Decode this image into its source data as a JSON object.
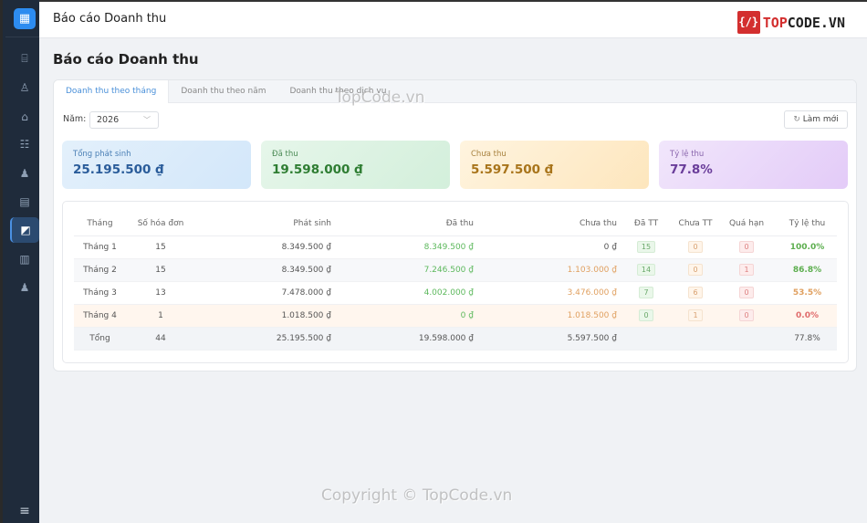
{
  "app": {
    "logo_icon": "building-icon",
    "header_title": "Báo cáo Doanh thu",
    "brand_prefix": "TOP",
    "brand_suffix": "CODE",
    "brand_dot": ".VN"
  },
  "sidebar": {
    "items": [
      {
        "icon": "presentation-chart-icon"
      },
      {
        "icon": "user-outline-icon"
      },
      {
        "icon": "home-icon"
      },
      {
        "icon": "checklist-icon"
      },
      {
        "icon": "user-icon"
      },
      {
        "icon": "document-icon"
      },
      {
        "icon": "chart-icon",
        "active": true
      },
      {
        "icon": "ledger-icon"
      },
      {
        "icon": "user-icon"
      }
    ],
    "toggle_icon": "menu-icon"
  },
  "page": {
    "title": "Báo cáo Doanh thu"
  },
  "tabs": [
    {
      "label": "Doanh thu theo tháng",
      "active": true
    },
    {
      "label": "Doanh thu theo năm"
    },
    {
      "label": "Doanh thu theo dịch vụ"
    }
  ],
  "filter": {
    "year_label": "Năm:",
    "year_value": "2026",
    "refresh_label": "Làm mới"
  },
  "stats": [
    {
      "label": "Tổng phát sinh",
      "value": "25.195.500 ₫",
      "color": "#2a5c9a"
    },
    {
      "label": "Đã thu",
      "value": "19.598.000 ₫",
      "color": "#2e7d32"
    },
    {
      "label": "Chưa thu",
      "value": "5.597.500 ₫",
      "color": "#a8741a"
    },
    {
      "label": "Tỷ lệ thu",
      "value": "77.8%",
      "color": "#6a3d9a"
    }
  ],
  "table": {
    "headers": [
      "Tháng",
      "Số hóa đơn",
      "Phát sinh",
      "Đã thu",
      "Chưa thu",
      "Đã TT",
      "Chưa TT",
      "Quá hạn",
      "Tỷ lệ thu"
    ],
    "rows": [
      [
        "Tháng 1",
        "15",
        "8.349.500 ₫",
        "8.349.500 ₫",
        "0 ₫",
        "15",
        "0",
        "0",
        "100.0%"
      ],
      [
        "Tháng 2",
        "15",
        "8.349.500 ₫",
        "7.246.500 ₫",
        "1.103.000 ₫",
        "14",
        "0",
        "1",
        "86.8%"
      ],
      [
        "Tháng 3",
        "13",
        "7.478.000 ₫",
        "4.002.000 ₫",
        "3.476.000 ₫",
        "7",
        "6",
        "0",
        "53.5%"
      ],
      [
        "Tháng 4",
        "1",
        "1.018.500 ₫",
        "0 ₫",
        "1.018.500 ₫",
        "0",
        "1",
        "0",
        "0.0%"
      ]
    ],
    "total": [
      "Tổng",
      "44",
      "25.195.500 ₫",
      "19.598.000 ₫",
      "5.597.500 ₫",
      "",
      "",
      "",
      "77.8%"
    ]
  },
  "watermarks": [
    "TopCode.vn",
    "Copyright © TopCode.vn"
  ]
}
